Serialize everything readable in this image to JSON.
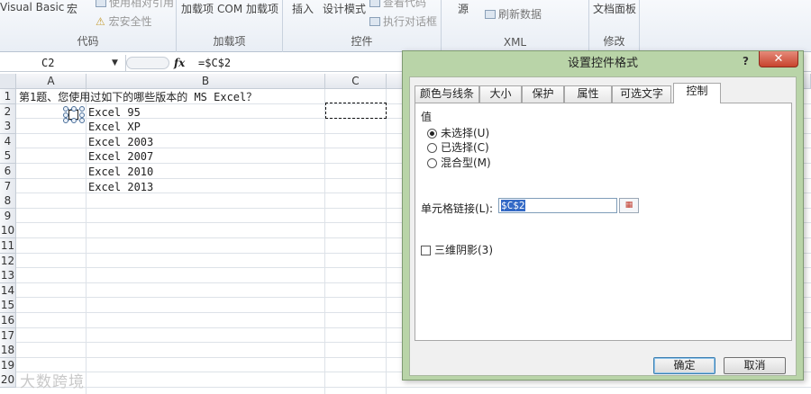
{
  "ribbon": {
    "groups": [
      {
        "name": "代码",
        "items": [
          "Visual Basic",
          "宏",
          "使用相对引用",
          "宏安全性"
        ]
      },
      {
        "name": "加载项",
        "items": [
          "加载项",
          "COM 加载项"
        ]
      },
      {
        "name": "控件",
        "items": [
          "插入",
          "设计模式",
          "查看代码",
          "执行对话框"
        ]
      },
      {
        "name": "XML",
        "items": [
          "源",
          "刷新数据"
        ]
      },
      {
        "name": "修改",
        "items": [
          "文档面板"
        ]
      }
    ]
  },
  "formula_bar": {
    "name_box": "C2",
    "fx": "fx",
    "formula": "=$C$2"
  },
  "sheet": {
    "columns": [
      "A",
      "B",
      "C"
    ],
    "rows": [
      "1",
      "2",
      "3",
      "4",
      "5",
      "6",
      "7",
      "8",
      "9",
      "10",
      "11",
      "12",
      "13",
      "14",
      "15",
      "16",
      "17",
      "18",
      "19",
      "20"
    ],
    "cells": {
      "A1": "第1题、您使用过如下的哪些版本的 MS Excel？",
      "B2": "Excel 95",
      "B3": "Excel XP",
      "B4": "Excel 2003",
      "B5": "Excel 2007",
      "B6": "Excel 2010",
      "B7": "Excel 2013"
    },
    "watermark": "大数跨境"
  },
  "dialog": {
    "title": "设置控件格式",
    "help": "?",
    "close": "✕",
    "tabs": [
      "颜色与线条",
      "大小",
      "保护",
      "属性",
      "可选文字",
      "控制"
    ],
    "active_tab": "控制",
    "section_value": "值",
    "radios": [
      {
        "label": "未选择(U)",
        "checked": true
      },
      {
        "label": "已选择(C)",
        "checked": false
      },
      {
        "label": "混合型(M)",
        "checked": false
      }
    ],
    "cell_link_label": "单元格链接(L):",
    "cell_link_value": "$C$2",
    "shading_3d_label": "三维阴影(3)",
    "ok": "确定",
    "cancel": "取消"
  }
}
